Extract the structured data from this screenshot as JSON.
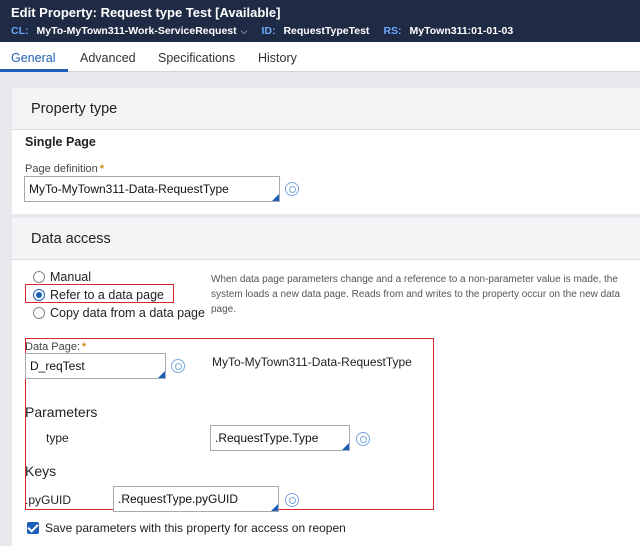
{
  "header": {
    "title": "Edit  Property: Request type Test [Available]",
    "cl_key": "CL:",
    "cl_value": "MyTo-MyTown311-Work-ServiceRequest",
    "id_key": "ID:",
    "id_value": "RequestTypeTest",
    "rs_key": "RS:",
    "rs_value": "MyTown311:01-01-03"
  },
  "tabs": [
    {
      "label": "General",
      "active": true
    },
    {
      "label": "Advanced"
    },
    {
      "label": "Specifications"
    },
    {
      "label": "History"
    }
  ],
  "property_type": {
    "heading": "Property type",
    "mode": "Single Page",
    "page_definition_label": "Page definition",
    "page_definition_value": "MyTo-MyTown311-Data-RequestType"
  },
  "data_access": {
    "heading": "Data access",
    "options": [
      {
        "label": "Manual",
        "selected": false
      },
      {
        "label": "Refer to a data page",
        "selected": true
      },
      {
        "label": "Copy data from a data page",
        "selected": false
      }
    ],
    "help_text": "When data page parameters change and a reference to a non-parameter value is made, the system loads a new data page. Reads from and writes to the property occur on the new data page.",
    "data_page_label": "Data Page:",
    "data_page_value": "D_reqTest",
    "data_page_class": "MyTo-MyTown311-Data-RequestType",
    "parameters_heading": "Parameters",
    "param_name": "type",
    "param_value": ".RequestType.Type",
    "keys_heading": "Keys",
    "key_name": ".pyGUID",
    "key_value": ".RequestType.pyGUID",
    "save_params_label": "Save parameters with this property for access on reopen",
    "save_params_checked": true
  },
  "colors": {
    "header_bg": "#1f2a44",
    "accent": "#1d5fb8",
    "highlight_red": "#d9262c",
    "required_star": "#d18b1c"
  }
}
